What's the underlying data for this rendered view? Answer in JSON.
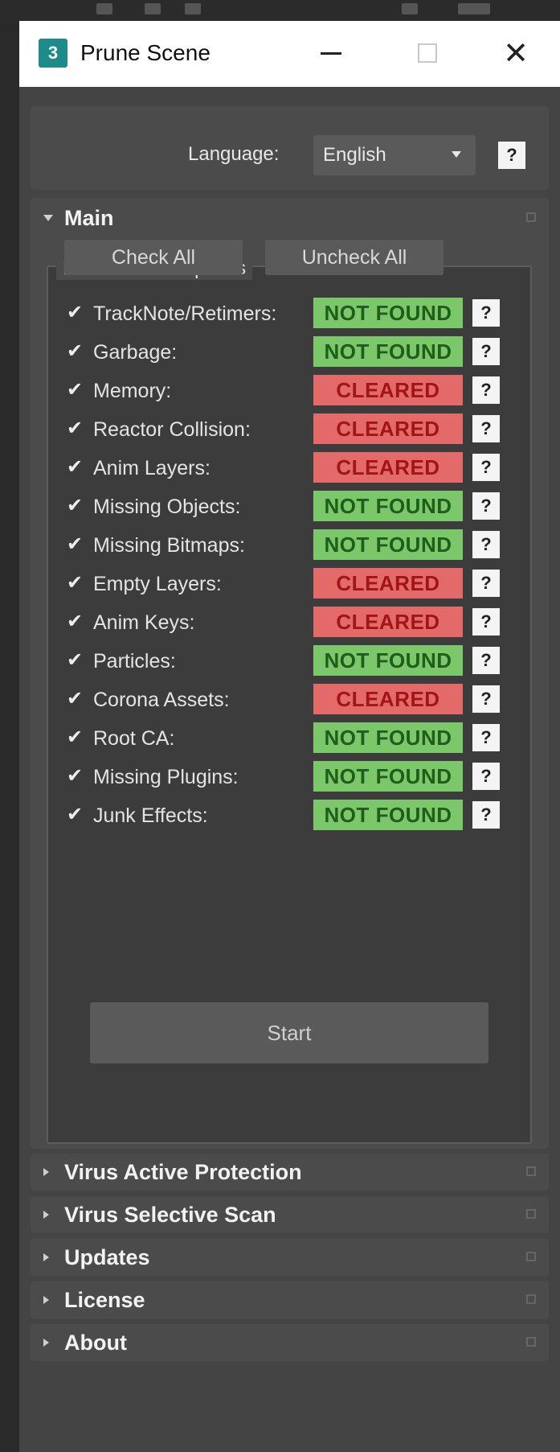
{
  "window": {
    "title": "Prune Scene",
    "app_icon_text": "3",
    "close_glyph": "✕"
  },
  "language": {
    "label": "Language:",
    "selected": "English",
    "help": "?"
  },
  "main": {
    "title": "Main",
    "group_title": "Prune Scene Options",
    "check_all": "Check All",
    "uncheck_all": "Uncheck All",
    "start": "Start",
    "options": [
      {
        "label": "TrackNote/Retimers:",
        "checked": true,
        "status": "NOT FOUND",
        "state": "nf",
        "help": "?"
      },
      {
        "label": "Garbage:",
        "checked": true,
        "status": "NOT FOUND",
        "state": "nf",
        "help": "?"
      },
      {
        "label": "Memory:",
        "checked": true,
        "status": "CLEARED",
        "state": "cl",
        "help": "?"
      },
      {
        "label": "Reactor Collision:",
        "checked": true,
        "status": "CLEARED",
        "state": "cl",
        "help": "?"
      },
      {
        "label": "Anim Layers:",
        "checked": true,
        "status": "CLEARED",
        "state": "cl",
        "help": "?"
      },
      {
        "label": "Missing Objects:",
        "checked": true,
        "status": "NOT FOUND",
        "state": "nf",
        "help": "?"
      },
      {
        "label": "Missing Bitmaps:",
        "checked": true,
        "status": "NOT FOUND",
        "state": "nf",
        "help": "?"
      },
      {
        "label": "Empty Layers:",
        "checked": true,
        "status": "CLEARED",
        "state": "cl",
        "help": "?"
      },
      {
        "label": "Anim Keys:",
        "checked": true,
        "status": "CLEARED",
        "state": "cl",
        "help": "?"
      },
      {
        "label": "Particles:",
        "checked": true,
        "status": "NOT FOUND",
        "state": "nf",
        "help": "?"
      },
      {
        "label": "Corona Assets:",
        "checked": true,
        "status": "CLEARED",
        "state": "cl",
        "help": "?"
      },
      {
        "label": "Root CA:",
        "checked": true,
        "status": "NOT FOUND",
        "state": "nf",
        "help": "?"
      },
      {
        "label": "Missing Plugins:",
        "checked": true,
        "status": "NOT FOUND",
        "state": "nf",
        "help": "?"
      },
      {
        "label": "Junk Effects:",
        "checked": true,
        "status": "NOT FOUND",
        "state": "nf",
        "help": "?"
      }
    ]
  },
  "rollouts": [
    {
      "title": "Virus Active Protection"
    },
    {
      "title": "Virus Selective Scan"
    },
    {
      "title": "Updates"
    },
    {
      "title": "License"
    },
    {
      "title": "About"
    }
  ],
  "colors": {
    "not_found_bg": "#7dc76b",
    "cleared_bg": "#e46a6a",
    "panel_bg": "#444444"
  },
  "icons": {
    "checkbox": "check-icon",
    "collapse": "triangle-icon",
    "help": "help-icon"
  }
}
